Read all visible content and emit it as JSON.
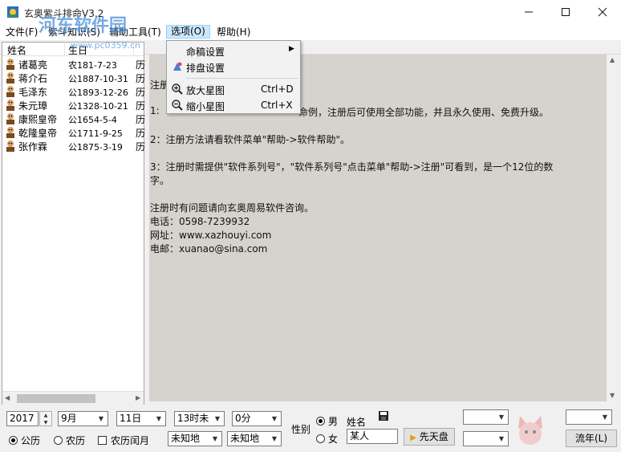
{
  "window": {
    "title": "玄奥紫斗排命V3.2",
    "minimize_icon": "minimize-icon",
    "maximize_icon": "maximize-icon",
    "close_icon": "close-icon"
  },
  "menubar": {
    "items": [
      "文件(F)",
      "紫斗知识(S)",
      "辅助工具(T)",
      "选项(O)",
      "帮助(H)"
    ],
    "active": "选项(O)"
  },
  "options_menu": {
    "items": [
      {
        "label": "命稿设置",
        "shortcut": "",
        "submenu": true,
        "icon": ""
      },
      {
        "label": "排盘设置",
        "shortcut": "",
        "submenu": false,
        "icon": "chart-settings-icon"
      },
      {
        "label": "放大星图",
        "shortcut": "Ctrl+D",
        "submenu": false,
        "icon": "zoom-in-icon"
      },
      {
        "label": "缩小星图",
        "shortcut": "Ctrl+X",
        "submenu": false,
        "icon": "zoom-out-icon"
      }
    ]
  },
  "list": {
    "columns": [
      "姓名",
      "生日"
    ],
    "rows": [
      {
        "name": "诸葛亮",
        "birth": "农181-7-23",
        "extra": "历"
      },
      {
        "name": "蒋介石",
        "birth": "公1887-10-31",
        "extra": "历"
      },
      {
        "name": "毛泽东",
        "birth": "公1893-12-26",
        "extra": "历"
      },
      {
        "name": "朱元璋",
        "birth": "公1328-10-21",
        "extra": "历"
      },
      {
        "name": "康熙皇帝",
        "birth": "公1654-5-4",
        "extra": "历"
      },
      {
        "name": "乾隆皇帝",
        "birth": "公1711-9-25",
        "extra": "历"
      },
      {
        "name": "张作霖",
        "birth": "公1875-3-19",
        "extra": "历"
      }
    ]
  },
  "text_panel": {
    "line1": "注册",
    "line2a": "1:",
    "line2b": "命例，注册后可使用全部功能，并且永久使用、免费升级。",
    "line3": "2：注册方法请看软件菜单\"帮助->软件帮助\"。",
    "line4": "3：注册时需提供\"软件系列号\"，\"软件系列号\"点击菜单\"帮助->注册\"可看到，是一个12位的数",
    "line4b": "字。",
    "line5": "注册时有问题请向玄奥周易软件咨询。",
    "phone": "电话：0598-7239932",
    "site": "网址：www.xazhouyi.com",
    "email": "电邮：xuanao@sina.com"
  },
  "controls": {
    "year": "2017",
    "month": "9月",
    "day": "11日",
    "hour": "13时未",
    "minute": "0分",
    "place1": "未知地",
    "place2": "未知地",
    "calendar_solar": "公历",
    "calendar_lunar": "农历",
    "leap_month": "农历闰月",
    "gender_label": "性别",
    "male": "男",
    "female": "女",
    "name_label": "姓名",
    "name_value": "某人",
    "xiantian_button": "先天盘",
    "liunian_button": "流年(L)",
    "solar_selected": true,
    "male_selected": true
  },
  "watermarks": {
    "site_name": "河东软件园",
    "site_url": "www.pc0359.cn"
  },
  "colors": {
    "menu_highlight": "#cce8ff",
    "panel_bg": "#d6d3ce",
    "watermark": "#4a90d9"
  }
}
